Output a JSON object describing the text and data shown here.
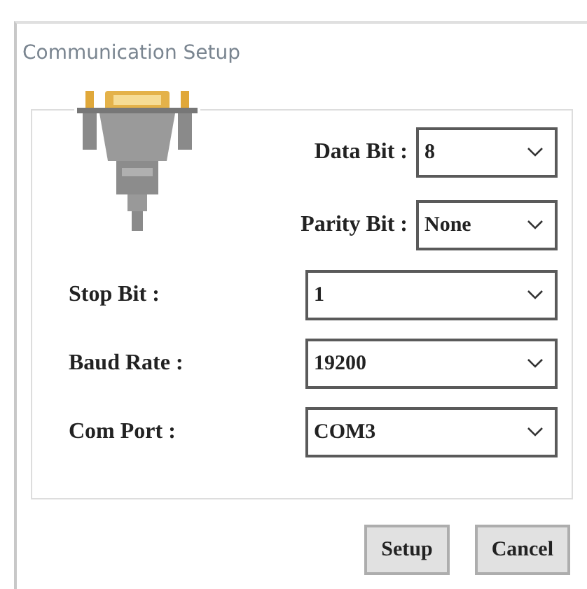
{
  "window": {
    "title": "Communication Setup"
  },
  "fields": [
    {
      "kind": "beside-icon",
      "label": "Data Bit :",
      "value": "8"
    },
    {
      "kind": "beside-icon",
      "label": "Parity Bit :",
      "value": "None"
    },
    {
      "kind": "full",
      "label": "Stop Bit :",
      "value": "1"
    },
    {
      "kind": "full",
      "label": "Baud Rate :",
      "value": "19200"
    },
    {
      "kind": "full",
      "label": "Com Port :",
      "value": "COM3"
    }
  ],
  "buttons": [
    "Setup",
    "Cancel"
  ]
}
